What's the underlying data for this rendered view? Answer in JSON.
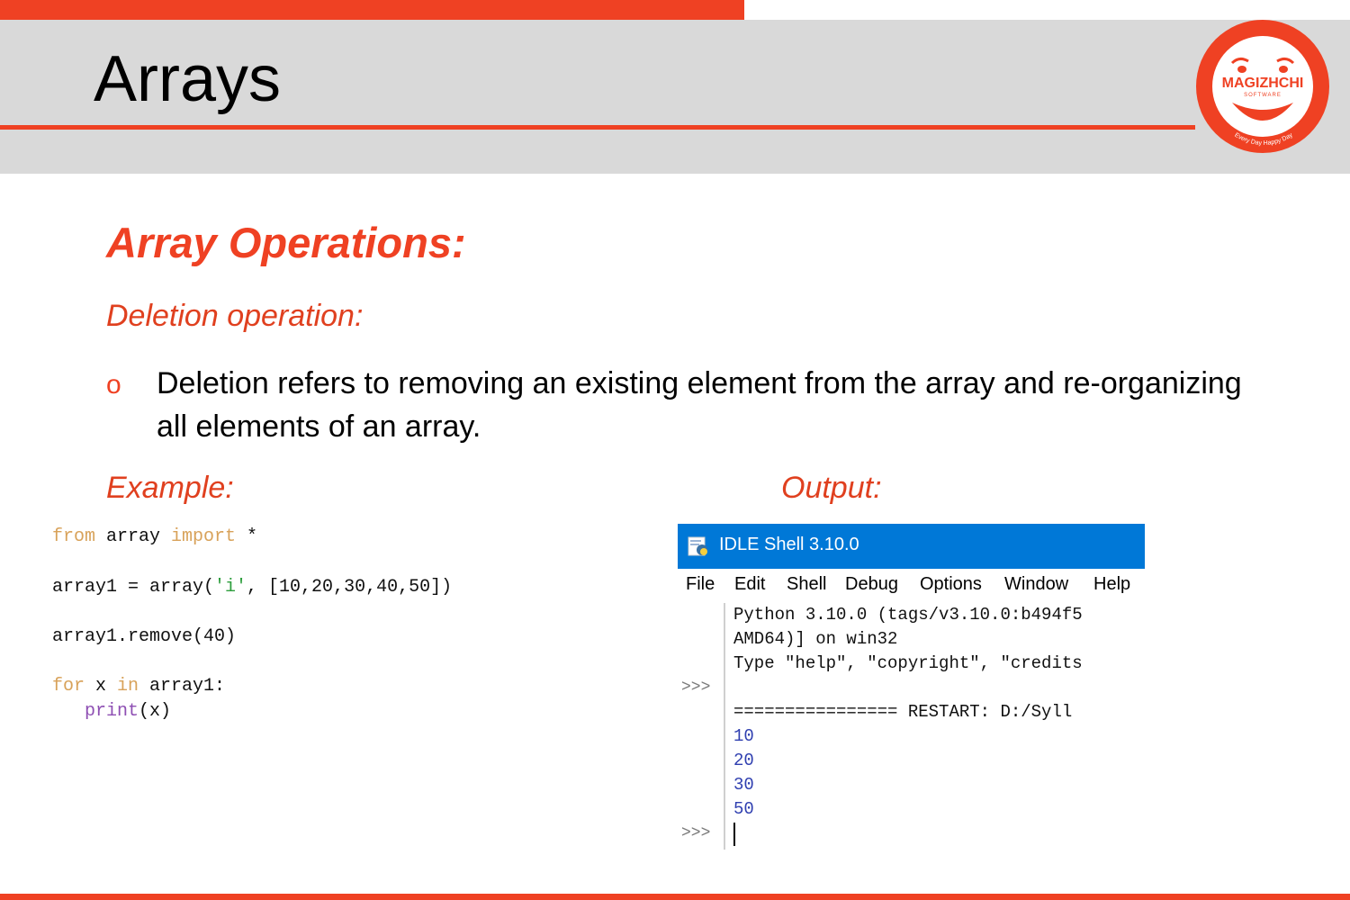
{
  "slide": {
    "title": "Arrays",
    "section_title": "Array Operations:",
    "subtitle": "Deletion operation:",
    "bullet_mark": "o",
    "bullet_text": "Deletion refers to removing an existing element from the array and re-organizing all elements of an array.",
    "example_label": "Example:",
    "output_label": "Output:"
  },
  "logo": {
    "brand": "MAGIZHCHI",
    "sub": "SOFTWARE",
    "tagline": "Every Day Happy Day"
  },
  "code": {
    "line1": {
      "kw1": "from",
      "mid": " array ",
      "kw2": "import",
      "end": " *"
    },
    "line2": {
      "pre": "array1 = array(",
      "str": "'i'",
      "post": ", [10,20,30,40,50])"
    },
    "line3": "array1.remove(40)",
    "line4": {
      "kw1": "for",
      "mid1": " x ",
      "kw2": "in",
      "end": " array1:"
    },
    "line5": {
      "indent": "   ",
      "bi": "print",
      "post": "(x)"
    }
  },
  "idle": {
    "window_title": "IDLE Shell 3.10.0",
    "menu": [
      "File",
      "Edit",
      "Shell",
      "Debug",
      "Options",
      "Window",
      "Help"
    ],
    "prompt": ">>>",
    "lines": [
      "Python 3.10.0 (tags/v3.10.0:b494f5",
      "AMD64)] on win32",
      "Type \"help\", \"copyright\", \"credits",
      "================ RESTART: D:/Syll"
    ],
    "outputs": [
      "10",
      "20",
      "30",
      "50"
    ]
  },
  "colors": {
    "accent": "#ef4123",
    "header_band": "#d9d9d9",
    "idle_titlebar": "#0078d7"
  }
}
